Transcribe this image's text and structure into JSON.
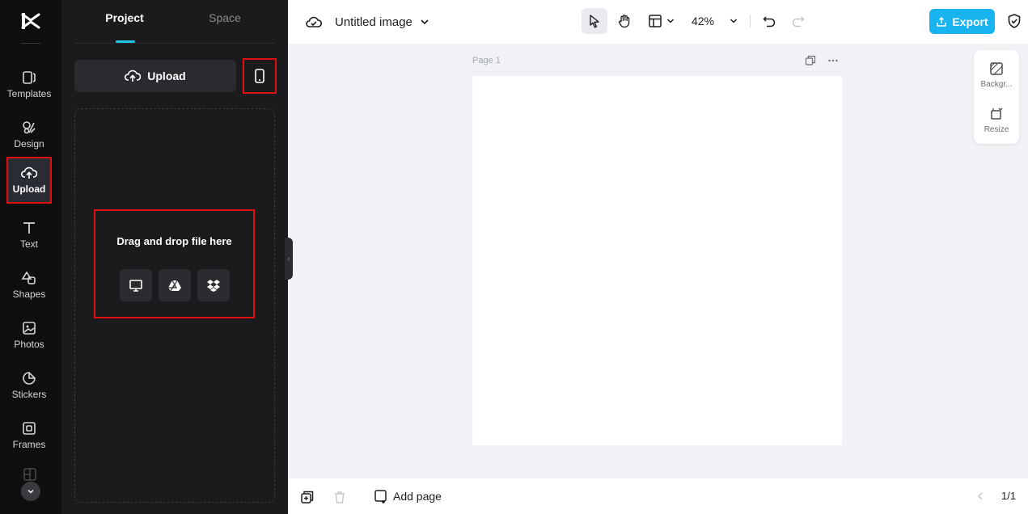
{
  "rail": {
    "items": [
      {
        "label": "Templates",
        "icon": "templates-icon"
      },
      {
        "label": "Design",
        "icon": "design-icon"
      },
      {
        "label": "Upload",
        "icon": "upload-cloud-icon"
      },
      {
        "label": "Text",
        "icon": "text-icon"
      },
      {
        "label": "Shapes",
        "icon": "shapes-icon"
      },
      {
        "label": "Photos",
        "icon": "photos-icon"
      },
      {
        "label": "Stickers",
        "icon": "stickers-icon"
      },
      {
        "label": "Frames",
        "icon": "frames-icon"
      }
    ],
    "active": "Upload"
  },
  "panel": {
    "tabs": [
      "Project",
      "Space"
    ],
    "active_tab": "Project",
    "upload_label": "Upload",
    "drop_text": "Drag and drop file here"
  },
  "topbar": {
    "title": "Untitled image",
    "zoom": "42%",
    "export_label": "Export"
  },
  "canvas": {
    "page_label": "Page 1"
  },
  "side": {
    "background_label": "Backgr...",
    "resize_label": "Resize"
  },
  "bottom": {
    "add_page_label": "Add page",
    "pager": "1/1"
  },
  "colors": {
    "accent": "#1fc7e6",
    "export": "#19b3f0",
    "highlight": "#e01010"
  }
}
